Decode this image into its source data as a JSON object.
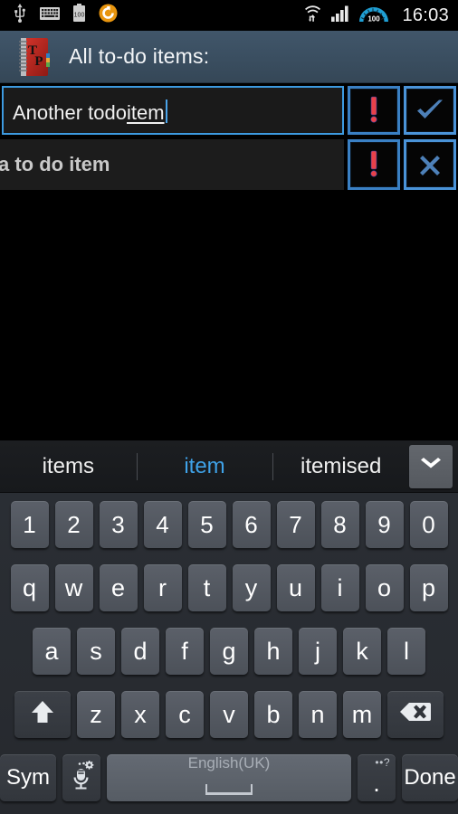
{
  "statusbar": {
    "left_icons": [
      "usb-icon",
      "keyboard-icon",
      "battery-icon",
      "sync-icon"
    ],
    "battery_level": "100",
    "right_icons": [
      "wifi-icon",
      "signal-icon",
      "data-gauge-icon"
    ],
    "gauge_value": "100",
    "clock": "16:03"
  },
  "appbar": {
    "icon_name": "todo-notebook-icon",
    "icon_letters": [
      "T",
      "P"
    ],
    "title": "All to-do items:"
  },
  "editrow": {
    "input_text_plain": "Another todo ",
    "input_text_composing": "item",
    "input_full_value": "Another todo item",
    "placeholder": "",
    "priority_button": "!",
    "confirm_button": "✔"
  },
  "listrow": {
    "item_text": "a to do item",
    "priority_button": "!",
    "delete_button": "✖"
  },
  "keyboard": {
    "suggestions": [
      {
        "label": "items",
        "highlighted": false
      },
      {
        "label": "item",
        "highlighted": true
      },
      {
        "label": "itemised",
        "highlighted": false
      }
    ],
    "expand_icon": "chevron-down-icon",
    "rows": {
      "numbers": [
        "1",
        "2",
        "3",
        "4",
        "5",
        "6",
        "7",
        "8",
        "9",
        "0"
      ],
      "top": [
        "q",
        "w",
        "e",
        "r",
        "t",
        "y",
        "u",
        "i",
        "o",
        "p"
      ],
      "home": [
        "a",
        "s",
        "d",
        "f",
        "g",
        "h",
        "j",
        "k",
        "l"
      ],
      "bottom": [
        "z",
        "x",
        "c",
        "v",
        "b",
        "n",
        "m"
      ]
    },
    "shift_label": "shift-icon",
    "backspace_label": "backspace-icon",
    "sym_label": "Sym",
    "mic_label": "mic-icon",
    "space_label": "English(UK)",
    "period_label": ".",
    "period_sup": "••?",
    "done_label": "Done"
  },
  "colors": {
    "accent_blue": "#3d9ae0",
    "header_slate": "#3a4e60",
    "alert_red": "#e8414a",
    "key_face": "#545a62"
  }
}
